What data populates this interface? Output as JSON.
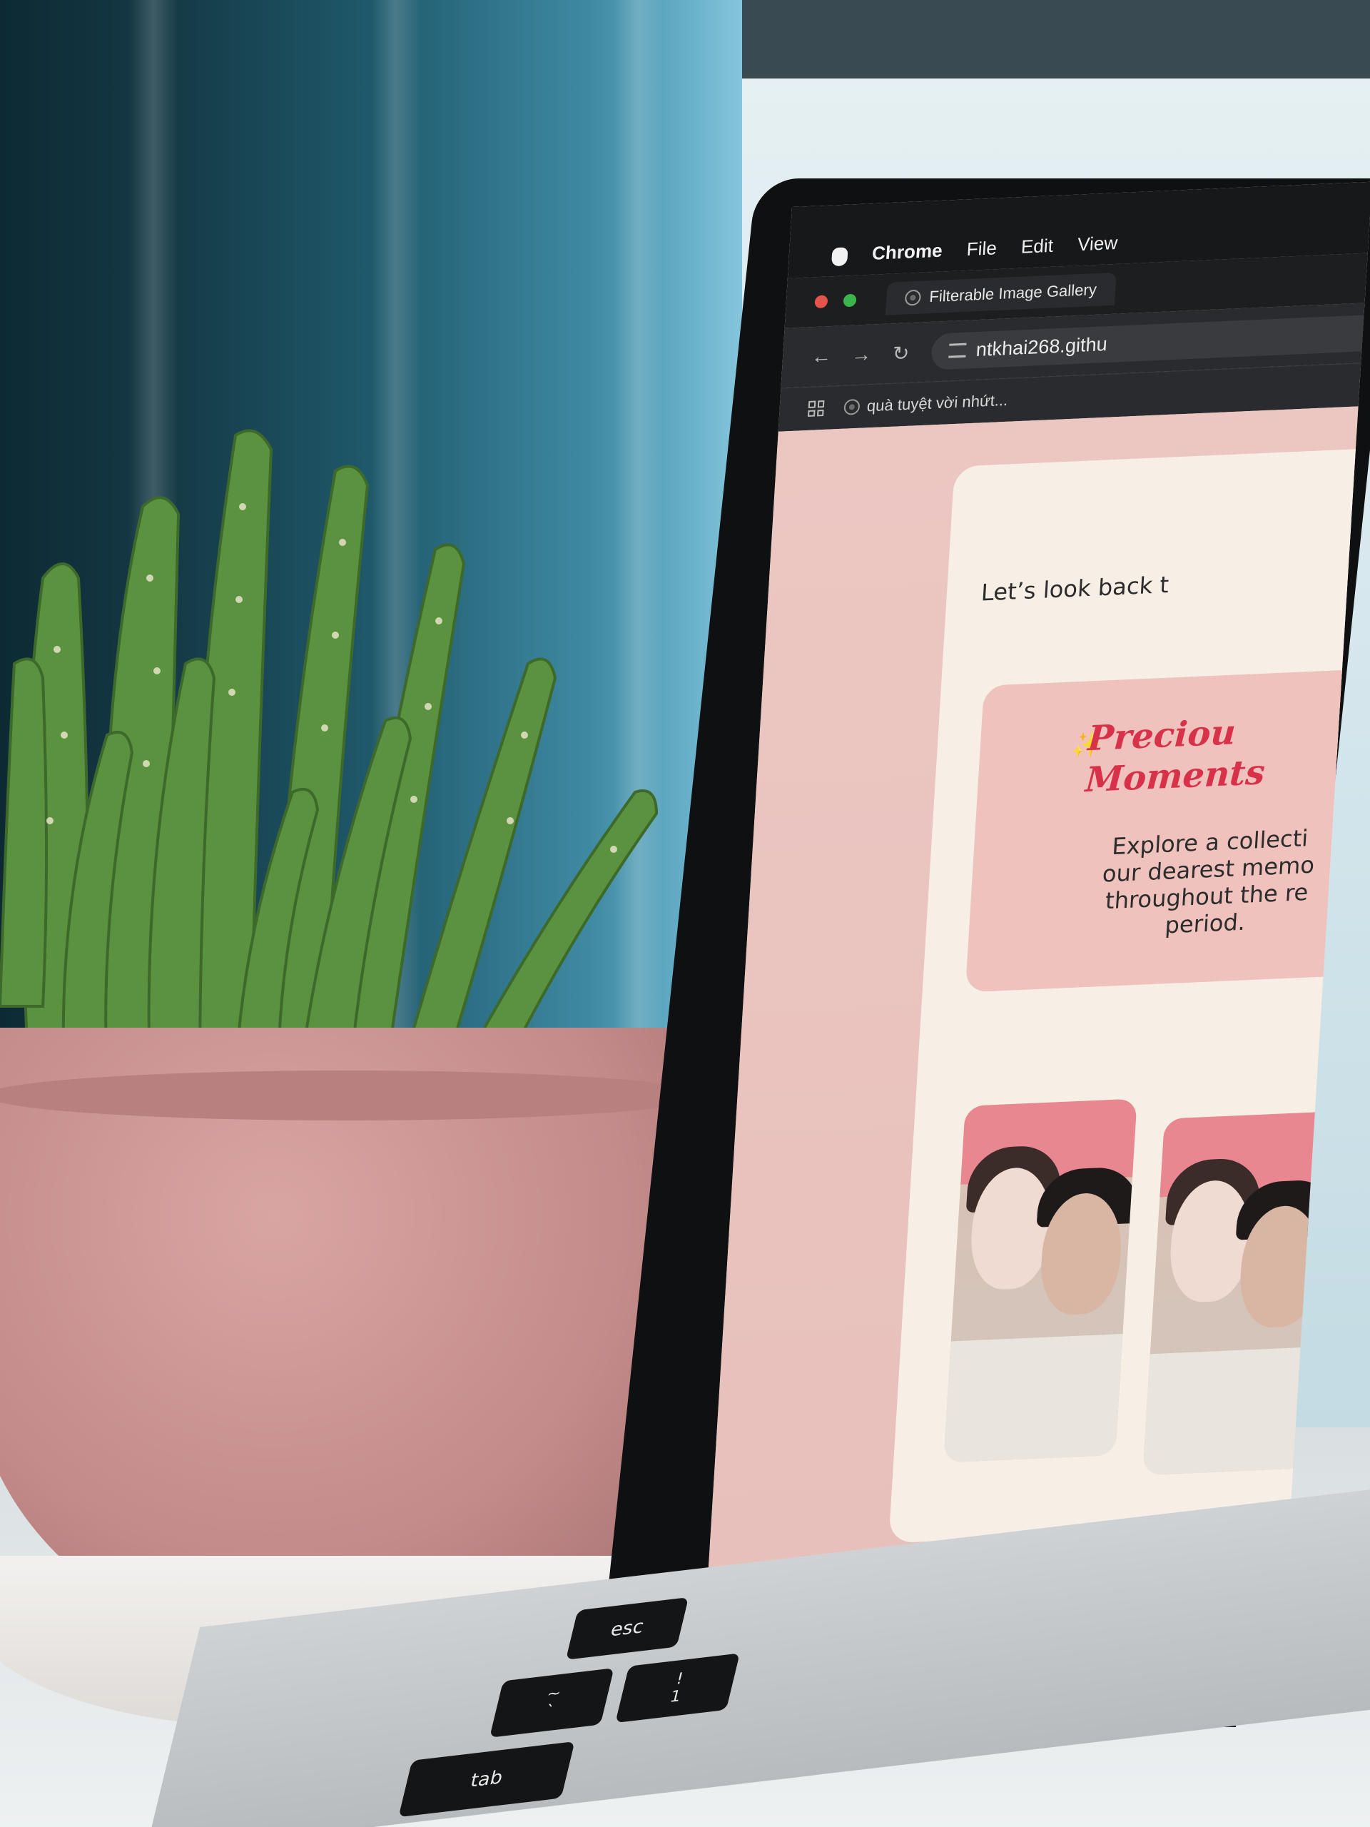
{
  "mac_menu": {
    "app_name": "Chrome",
    "items": [
      "File",
      "Edit",
      "View"
    ]
  },
  "browser": {
    "tab_title": "Filterable Image Gallery",
    "url": "ntkhai268.githu",
    "bookmark": "quà tuyệt vời nhứt..."
  },
  "webpage": {
    "tagline": "Let’s look back t",
    "hero_title_line1": "Preciou",
    "hero_title_line2": "Moments",
    "hero_description": [
      "Explore a collecti",
      "our dearest memo",
      "throughout the re",
      "period."
    ]
  },
  "keyboard": {
    "esc": "esc",
    "tab": "tab",
    "tilde_top": "~",
    "tilde_bottom": "`",
    "one_top": "!",
    "one_bottom": "1"
  },
  "colors": {
    "page_bg": "#e9c1bd",
    "card_bg": "#f7efe6",
    "hero_bg": "#efc2bd",
    "title_red": "#d8324a",
    "pot_pink": "#c38b8a",
    "cactus_green": "#5a8f3a"
  },
  "icons": [
    "apple-icon",
    "globe-icon",
    "back-arrow-icon",
    "forward-arrow-icon",
    "reload-icon",
    "tune-icon",
    "apps-grid-icon",
    "sparkle-icon"
  ]
}
